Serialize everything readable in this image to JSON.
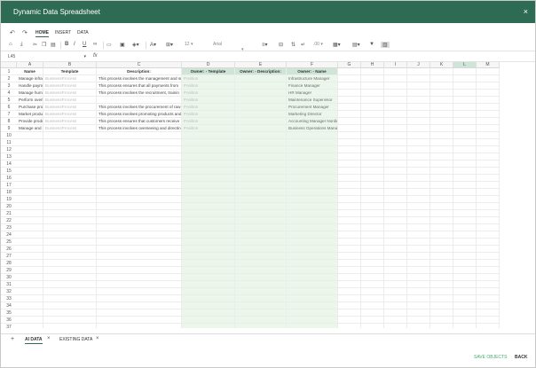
{
  "window": {
    "title": "Dynamic Data Spreadsheet",
    "close_label": "×"
  },
  "ribbon": {
    "tabs": [
      "HOME",
      "INSERT",
      "DATA"
    ],
    "active_tab": "HOME"
  },
  "toolbar": {
    "font_size": "12",
    "font_name": "Arial",
    "number_format": ".00"
  },
  "formula_bar": {
    "cell_ref": "L45",
    "fx_label": "fx",
    "value": ""
  },
  "grid": {
    "column_letters": [
      "A",
      "B",
      "C",
      "D",
      "E",
      "F",
      "G",
      "H",
      "I",
      "J",
      "K",
      "L",
      "M"
    ],
    "selected_column": "L",
    "header_row": [
      "Name",
      "Template",
      "Description:",
      "Owner: - Template",
      "Owner: - Description:",
      "Owner: - Name",
      "",
      "",
      "",
      "",
      "",
      "",
      ""
    ],
    "rows": [
      [
        "Manage infrastructure",
        "BusinessProcess",
        "This process involves the management and su",
        "Position",
        "",
        "Infrastructure Manager"
      ],
      [
        "Handle payment",
        "BusinessProcess",
        "This process ensures that all payments from",
        "Position",
        "",
        "Finance Manager"
      ],
      [
        "Manage human resources",
        "BusinessProcess",
        "This process involves the recruitment, trainin",
        "Position",
        "",
        "HR Manager"
      ],
      [
        "Perform overhaul",
        "BusinessProcess",
        "",
        "Position",
        "",
        "Maintenance Supervisor"
      ],
      [
        "Purchase product",
        "BusinessProcess",
        "This process involves the procurement of raw",
        "Position",
        "",
        "Procurement Manager"
      ],
      [
        "Market product and service",
        "BusinessProcess",
        "This process involves promoting products and",
        "Position",
        "",
        "Marketing Director"
      ],
      [
        "Provide product",
        "BusinessProcess",
        "This process ensures that customers receive",
        "Position",
        "",
        "Accounting Manager Nordic"
      ],
      [
        "Manage and control business",
        "BusinessProcess",
        "This process involves overseeing and directin",
        "Position",
        "",
        "Business Operations Manager"
      ]
    ],
    "row_numbers": [
      "1",
      "2",
      "3",
      "4",
      "5",
      "6",
      "7",
      "8",
      "9",
      "10",
      "11",
      "12",
      "13",
      "14",
      "15",
      "16",
      "17",
      "18",
      "19",
      "20",
      "21",
      "22",
      "23",
      "24",
      "25",
      "26",
      "27",
      "28",
      "29",
      "30",
      "31",
      "32",
      "33",
      "34",
      "35",
      "36",
      "37"
    ]
  },
  "sheets": {
    "add_label": "+",
    "tabs": [
      {
        "label": "AI DATA",
        "active": true
      },
      {
        "label": "EXISTING DATA",
        "active": false
      }
    ],
    "close_label": "×"
  },
  "footer": {
    "save_label": "SAVE OBJECTS",
    "back_label": "BACK"
  },
  "colors": {
    "titlebar": "#2e6b55",
    "header_green": "#cfe5d8",
    "column_tint": "#ecf7ec",
    "save_link": "#4aa86f"
  }
}
